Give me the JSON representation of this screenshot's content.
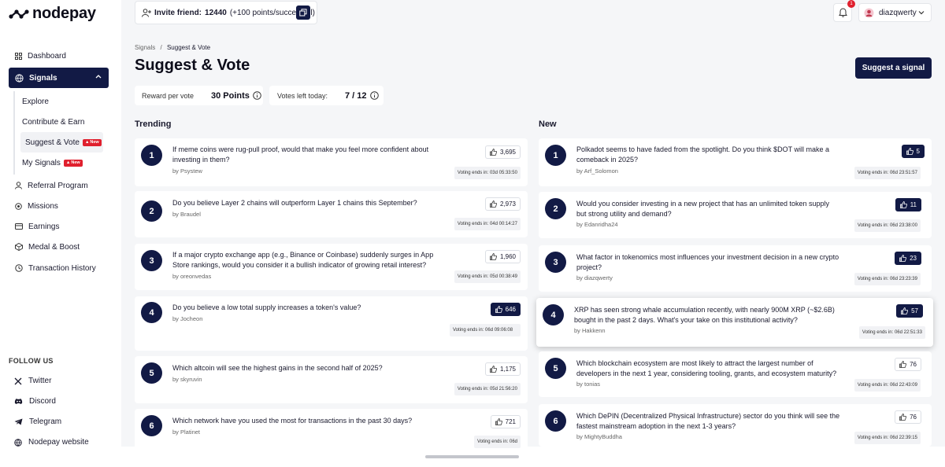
{
  "app": {
    "name": "nodepay"
  },
  "sidebar": {
    "items": [
      {
        "label": "Dashboard",
        "icon": "dashboard-icon"
      },
      {
        "label": "Signals",
        "icon": "signals-icon"
      },
      {
        "label": "Referral Program",
        "icon": "referral-icon"
      },
      {
        "label": "Missions",
        "icon": "missions-icon"
      },
      {
        "label": "Earnings",
        "icon": "earnings-icon"
      },
      {
        "label": "Medal & Boost",
        "icon": "medal-icon"
      },
      {
        "label": "Transaction History",
        "icon": "history-icon"
      }
    ],
    "sub_items": [
      {
        "label": "Explore"
      },
      {
        "label": "Contribute & Earn"
      },
      {
        "label": "Suggest & Vote",
        "badge": "New"
      },
      {
        "label": "My Signals",
        "badge": "New"
      }
    ],
    "follow_label": "FOLLOW US",
    "socials": [
      {
        "label": "Twitter",
        "icon": "x-icon"
      },
      {
        "label": "Discord",
        "icon": "discord-icon"
      },
      {
        "label": "Telegram",
        "icon": "telegram-icon"
      },
      {
        "label": "Nodepay website",
        "icon": "globe-icon"
      }
    ]
  },
  "header": {
    "invite_label": "Invite friend:",
    "invite_count": "12440",
    "invite_note": "(+100 points/successful)",
    "notification_count": "1",
    "username": "diazqwerty"
  },
  "page": {
    "breadcrumb_parent": "Signals",
    "breadcrumb_sep": "/",
    "breadcrumb_current": "Suggest & Vote",
    "title": "Suggest & Vote",
    "suggest_button": "Suggest a signal",
    "reward_label": "Reward per vote",
    "reward_value": "30 Points",
    "votes_label": "Votes left today:",
    "votes_value": "7 / 12"
  },
  "trending": {
    "heading": "Trending",
    "items": [
      {
        "rank": "1",
        "question": "If meme coins were rug-pull proof, would that make you feel more confident about investing in them?",
        "author": "by Psystew",
        "votes": "3,695",
        "ends": "Voting ends in: 03d 05:33:50"
      },
      {
        "rank": "2",
        "question": "Do you believe Layer 2 chains will outperform Layer 1 chains this September?",
        "author": "by Braudel",
        "votes": "2,973",
        "ends": "Voting ends in: 04d 00:14:27"
      },
      {
        "rank": "3",
        "question": "If a major crypto exchange app (e.g., Binance or Coinbase) suddenly surges in App Store rankings, would you consider it a bullish indicator of growing retail interest?",
        "author": "by oreonvedas",
        "votes": "1,960",
        "ends": "Voting ends in: 05d 00:38:49"
      },
      {
        "rank": "4",
        "question": "Do you believe a low total supply increases a token's value?",
        "author": "by Jocheon",
        "votes": "646",
        "ends": "Voting ends in: 06d 09:06:08"
      },
      {
        "rank": "5",
        "question": "Which altcoin will see the highest gains in the second half of 2025?",
        "author": "by skyruvin",
        "votes": "1,175",
        "ends": "Voting ends in: 05d 21:56:20"
      },
      {
        "rank": "6",
        "question": "Which network have you used the most for transactions in the past 30 days?",
        "author": "by Platinet",
        "votes": "721",
        "ends": "Voting ends in: 06d"
      }
    ]
  },
  "new": {
    "heading": "New",
    "items": [
      {
        "rank": "1",
        "question": "Polkadot seems to have faded from the spotlight. Do you think $DOT will make a comeback in 2025?",
        "author": "by Arf_Solomon",
        "votes": "5",
        "ends": "Voting ends in: 06d 23:51:57"
      },
      {
        "rank": "2",
        "question": "Would you consider investing in a new project that has an unlimited token supply but strong utility and demand?",
        "author": "by Edanridha24",
        "votes": "11",
        "ends": "Voting ends in: 06d 23:38:00"
      },
      {
        "rank": "3",
        "question": "What factor in tokenomics most influences your investment decision in a new crypto project?",
        "author": "by diazqwerty",
        "votes": "23",
        "ends": "Voting ends in: 06d 23:23:39"
      },
      {
        "rank": "4",
        "question": "XRP has seen strong whale accumulation recently, with nearly 900M XRP (~$2.6B) bought in the past 2 days. What's your take on this institutional activity?",
        "author": "by Hakkenn",
        "votes": "57",
        "ends": "Voting ends in: 06d 22:51:33"
      },
      {
        "rank": "5",
        "question": "Which blockchain ecosystem are most likely to attract the largest number of developers in the next 1 year, considering tooling, grants, and ecosystem maturity?",
        "author": "by tonias",
        "votes": "76",
        "ends": "Voting ends in: 06d 22:43:09"
      },
      {
        "rank": "6",
        "question": "Which DePIN (Decentralized Physical Infrastructure) sector do you think will see the fastest mainstream adoption in the next 1-3 years?",
        "author": "by MightyBuddha",
        "votes": "76",
        "ends": "Voting ends in: 06d 22:39:15"
      }
    ]
  },
  "colors": {
    "primary": "#121a45",
    "badge_red": "#e0202e",
    "background": "#f5f6f8"
  }
}
